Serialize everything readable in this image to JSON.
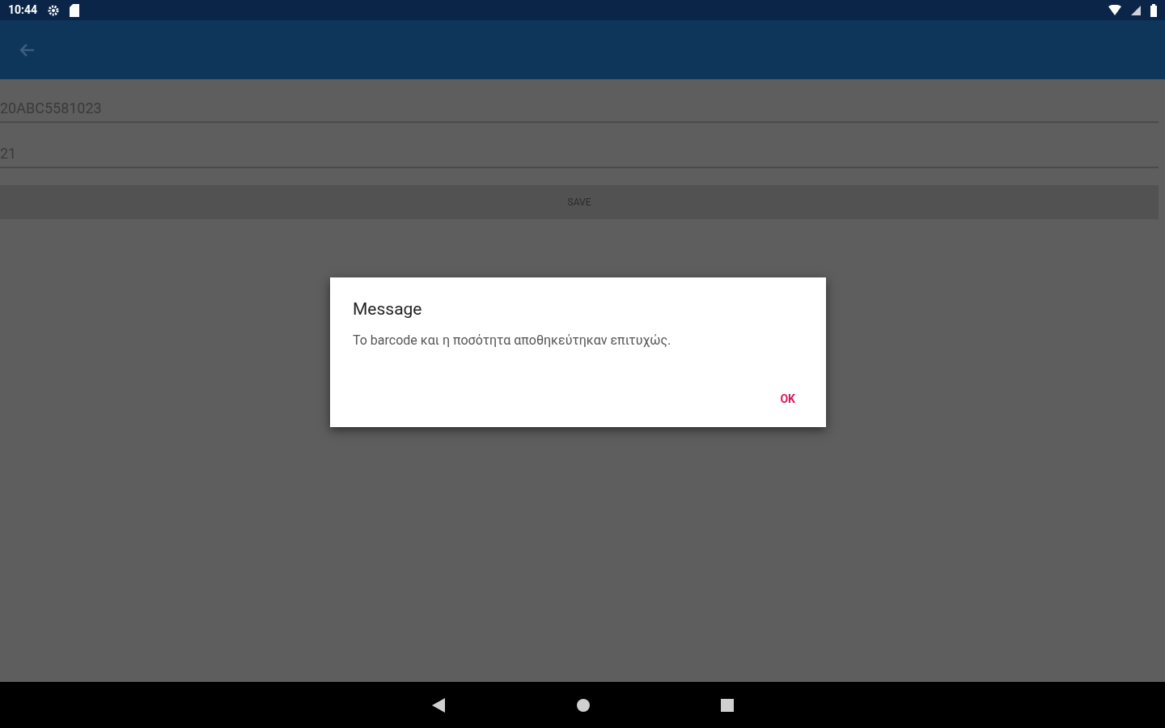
{
  "status_bar": {
    "time": "10:44"
  },
  "fields": [
    {
      "value": "20ABC5581023"
    },
    {
      "value": "21"
    }
  ],
  "save_button": {
    "label": "SAVE"
  },
  "dialog": {
    "title": "Message",
    "message": "Το barcode και η ποσότητα αποθηκεύτηκαν επιτυχώς.",
    "button": "OK"
  }
}
